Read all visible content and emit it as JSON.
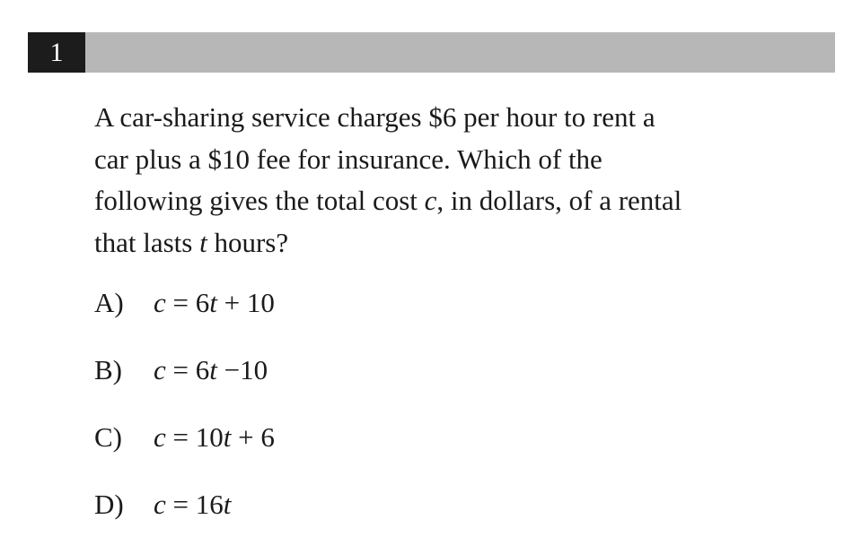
{
  "question": {
    "number": "1",
    "lines": [
      [
        "A car-sharing service charges $6 per hour to rent a"
      ],
      [
        "car plus a $10 fee for insurance. Which of the"
      ],
      [
        "following gives the total cost ",
        {
          "var": "c"
        },
        ", in dollars, of a rental"
      ],
      [
        "that lasts ",
        {
          "var": "t"
        },
        " hours?"
      ]
    ]
  },
  "choices": [
    {
      "letter": "A)",
      "expr": [
        {
          "var": "c"
        },
        " = 6",
        {
          "var": "t"
        },
        " + 10"
      ]
    },
    {
      "letter": "B)",
      "expr": [
        {
          "var": "c"
        },
        " = 6",
        {
          "var": "t"
        },
        " −10"
      ]
    },
    {
      "letter": "C)",
      "expr": [
        {
          "var": "c"
        },
        " = 10",
        {
          "var": "t"
        },
        " + 6"
      ]
    },
    {
      "letter": "D)",
      "expr": [
        {
          "var": "c"
        },
        " = 16",
        {
          "var": "t"
        }
      ]
    }
  ]
}
